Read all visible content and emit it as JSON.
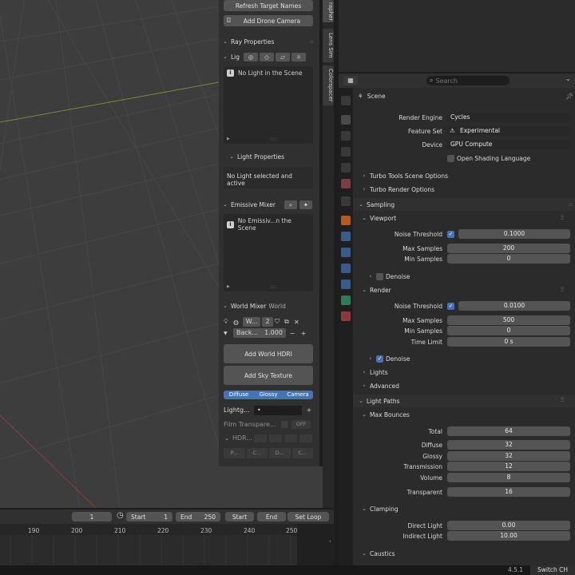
{
  "npanel": {
    "refresh_target_names": "Refresh Target Names",
    "add_drone_camera": "Add Drone Camera",
    "ray_properties": "Ray Properties",
    "lights_head": "Lig",
    "no_light_in_scene": "No Light in the Scene",
    "light_properties": "Light Properties",
    "no_light_selected": "No Light selected and active",
    "emissive_mixer": "Emissive Mixer",
    "no_emissive": "No Emissiv...n the Scene",
    "world_mixer": "World Mixer",
    "world_label": "World",
    "world_name": "W...",
    "world_users": "2",
    "background_label": "Back...",
    "background_value": "1.000",
    "add_world_hdri": "Add World HDRI",
    "add_sky_texture": "Add Sky Texture",
    "toggle_diffuse": "Diffuse",
    "toggle_glossy": "Glossy",
    "toggle_camera": "Camera",
    "lightgroup_label": "Lightg...",
    "lightgroup_value": "•",
    "film_transparent": "Film Transpare...",
    "off": "OFF",
    "hdri_label": "HDR...",
    "bottom_items": [
      "P...",
      "C...",
      "D...",
      "C..."
    ]
  },
  "side_tabs": [
    "rapher",
    "Lens Sim",
    "Colorspacer"
  ],
  "timeline": {
    "current_frame": "1",
    "start_label": "Start",
    "start_value": "1",
    "end_label": "End",
    "end_value": "250",
    "start_button": "Start",
    "end_button": "End",
    "set_loop": "Set Loop",
    "ticks": [
      "190",
      "200",
      "210",
      "220",
      "230",
      "240",
      "250"
    ]
  },
  "props": {
    "search_placeholder": "Search",
    "context": "Scene",
    "render_engine_label": "Render Engine",
    "render_engine": "Cycles",
    "feature_set_label": "Feature Set",
    "feature_set": "Experimental",
    "device_label": "Device",
    "device": "GPU Compute",
    "osl": "Open Shading Language",
    "turbo_tools": "Turbo Tools Scene Options",
    "turbo_render": "Turbo Render Options",
    "sampling": "Sampling",
    "viewport": "Viewport",
    "noise_threshold_label": "Noise Threshold",
    "vp_noise_threshold": "0.1000",
    "max_samples_label": "Max Samples",
    "vp_max_samples": "200",
    "min_samples_label": "Min Samples",
    "vp_min_samples": "0",
    "denoise": "Denoise",
    "render": "Render",
    "r_noise_threshold": "0.0100",
    "r_max_samples": "500",
    "r_min_samples": "0",
    "time_limit_label": "Time Limit",
    "time_limit": "0 s",
    "lights": "Lights",
    "advanced": "Advanced",
    "light_paths": "Light Paths",
    "max_bounces": "Max Bounces",
    "total_label": "Total",
    "total": "64",
    "diffuse_label": "Diffuse",
    "diffuse": "32",
    "glossy_label": "Glossy",
    "glossy": "32",
    "transmission_label": "Transmission",
    "transmission": "12",
    "volume_label": "Volume",
    "volume": "8",
    "transparent_label": "Transparent",
    "transparent": "16",
    "clamping": "Clamping",
    "direct_light_label": "Direct Light",
    "direct_light": "0.00",
    "indirect_light_label": "Indirect Light",
    "indirect_light": "10.00",
    "caustics": "Caustics"
  },
  "status": {
    "version": "4.5.1",
    "switch": "Switch CH"
  },
  "colors": {
    "accent": "#4772b3",
    "viewport_bg": "#3d3d3d",
    "panel_bg": "#2b2b2b"
  }
}
